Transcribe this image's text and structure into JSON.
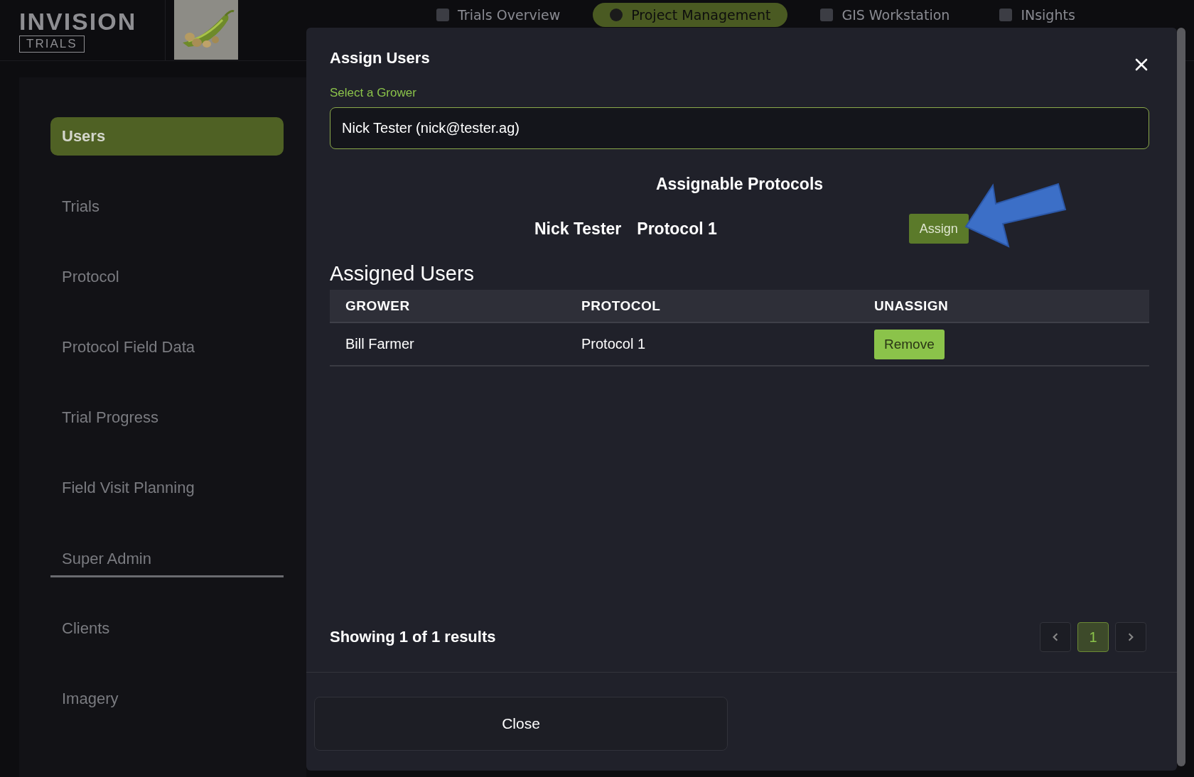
{
  "header": {
    "logo_title": "INVISION",
    "logo_subtitle": "TRIALS",
    "nav": [
      {
        "label": "Trials Overview",
        "selected": false
      },
      {
        "label": "Project Management",
        "selected": true
      },
      {
        "label": "GIS Workstation",
        "selected": false
      },
      {
        "label": "INsights",
        "selected": false
      }
    ]
  },
  "sidebar": {
    "items": [
      {
        "label": "Users",
        "kind": "item",
        "selected": true
      },
      {
        "label": "Trials",
        "kind": "item",
        "selected": false
      },
      {
        "label": "Protocol",
        "kind": "item",
        "selected": false
      },
      {
        "label": "Protocol Field Data",
        "kind": "item",
        "selected": false
      },
      {
        "label": "Trial Progress",
        "kind": "item",
        "selected": false
      },
      {
        "label": "Field Visit Planning",
        "kind": "item",
        "selected": false
      },
      {
        "label": "Super Admin",
        "kind": "section"
      },
      {
        "label": "Clients",
        "kind": "item",
        "selected": false
      },
      {
        "label": "Imagery",
        "kind": "item",
        "selected": false
      }
    ]
  },
  "modal": {
    "title": "Assign Users",
    "grower_label": "Select a Grower",
    "grower_value": "Nick Tester (nick@tester.ag)",
    "assignable_title": "Assignable Protocols",
    "assignable": [
      {
        "grower": "Nick Tester",
        "protocol": "Protocol 1",
        "action": "Assign"
      }
    ],
    "assigned_title": "Assigned Users",
    "table": {
      "columns": [
        "GROWER",
        "PROTOCOL",
        "UNASSIGN"
      ],
      "rows": [
        {
          "grower": "Bill Farmer",
          "protocol": "Protocol 1",
          "action": "Remove"
        }
      ]
    },
    "results": "Showing 1 of 1 results",
    "pages": [
      {
        "label": "1",
        "selected": true
      }
    ],
    "close": "Close"
  }
}
